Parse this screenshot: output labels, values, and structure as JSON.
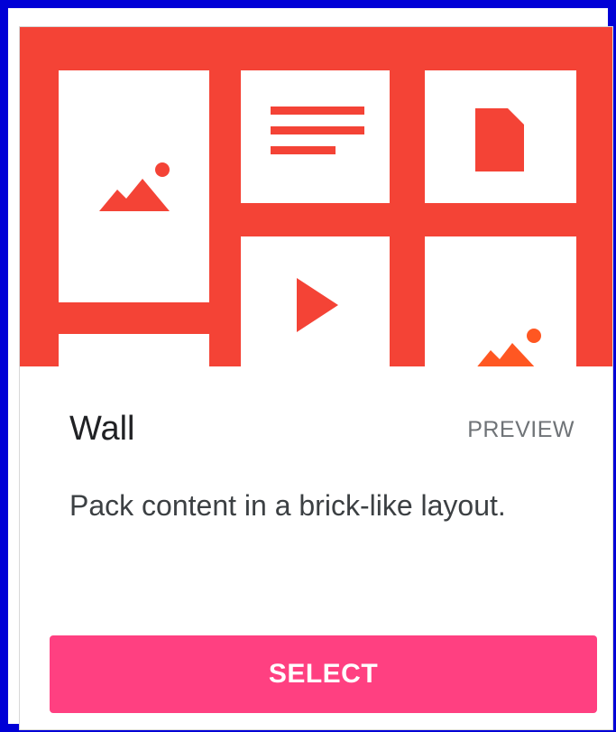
{
  "colors": {
    "accent": "#f44336",
    "button": "#ff4081",
    "frame_border": "#0000d6"
  },
  "card": {
    "title": "Wall",
    "preview_label": "PREVIEW",
    "description": "Pack content in a brick-like layout.",
    "select_label": "SELECT"
  },
  "illustration": {
    "tiles": [
      {
        "icon": "image-icon"
      },
      {
        "icon": "text-lines-icon"
      },
      {
        "icon": "document-icon"
      },
      {
        "icon": "play-icon"
      },
      {
        "icon": "image-icon"
      }
    ]
  }
}
